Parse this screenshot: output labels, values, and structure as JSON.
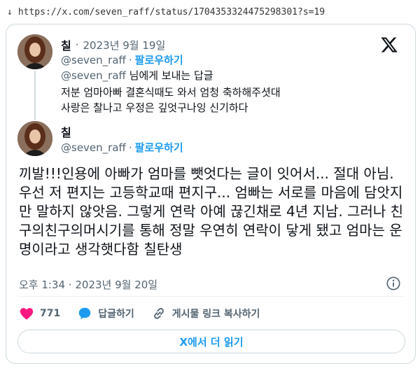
{
  "browser": {
    "url": "https://x.com/seven_raff/status/1704353324475298301?s=19",
    "download_arrow": "↓"
  },
  "logo": {
    "icon": "x-logo-icon"
  },
  "reply_tweet": {
    "name": "칠",
    "separator": "·",
    "date": "2023년 9월 19일",
    "handle": "@seven_raff",
    "follow_label": "팔로우하기",
    "reply_to_handle": "@seven_raff",
    "reply_to_text": "님에게 보내는 답글",
    "text_line1": "저분 엄마아빠 결혼식때도 와서 엄청 축하해주셧대",
    "text_line2": "사랑은 찰나고 우정은 깊엇구나잉 신기하다"
  },
  "main_tweet": {
    "name": "칠",
    "handle": "@seven_raff",
    "separator": "·",
    "follow_label": "팔로우하기",
    "text": "끼발!!!인용에 아빠가 엄마를 뺏엇다는 글이 잇어서... 절대 아님. 우선 저 편지는 고등학교때 편지구... 엄빠는 서로를 마음에 담앗지만 말하지 않앗음. 그렇게 연락 아예 끊긴채로 4년 지남. 그러나 친구의친구의머시기를 통해 정말 우연히 연락이 닿게 됐고 엄마는 운명이라고 생각햇다함 칠탄생",
    "timestamp": "오후 1:34 · 2023년 9월 20일"
  },
  "actions": {
    "like_count": "771",
    "reply_label": "답글하기",
    "share_label": "게시물 링크 복사하기"
  },
  "read_more_label": "X에서 더 읽기",
  "colors": {
    "accent": "#1d9bf0",
    "like": "#f91880",
    "text": "#0f1419",
    "muted": "#536471",
    "border": "#cfd9de"
  }
}
